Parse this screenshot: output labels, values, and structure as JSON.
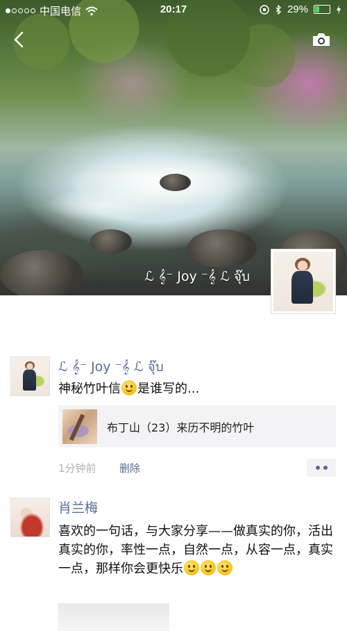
{
  "status_bar": {
    "carrier": "中国电信",
    "time": "20:17",
    "battery": "29%",
    "battery_level": 0.29,
    "signal_strength": 1,
    "signal_max": 5
  },
  "header": {
    "back_icon": "chevron-left-icon",
    "camera_icon": "camera-icon"
  },
  "profile": {
    "name": "ℒ 𝄞⁻ Joy ⁻𝄞 ℒ จุ๊บ",
    "cover_description_icon": "stream-cover-photo"
  },
  "posts": [
    {
      "author": "ℒ 𝄞⁻ Joy ⁻𝄞 ℒ จุ๊บ",
      "text_before_emoji": "神秘竹叶信",
      "text_after_emoji": "是谁写的...",
      "shared_link": {
        "title": "布丁山（23）来历不明的竹叶"
      },
      "time": "1分钟前",
      "delete_label": "删除",
      "more_icon": "more-dots-icon"
    },
    {
      "author": "肖兰梅",
      "text": "喜欢的一句话，与大家分享——做真实的你，活出真实的你，率性一点，自然一点，从容一点，真实一点，那样你会更快乐"
    }
  ],
  "colors": {
    "link_blue": "#576b95",
    "time_gray": "#b2b2b2",
    "card_bg": "#f3f3f5",
    "battery_green": "#4cd964"
  }
}
